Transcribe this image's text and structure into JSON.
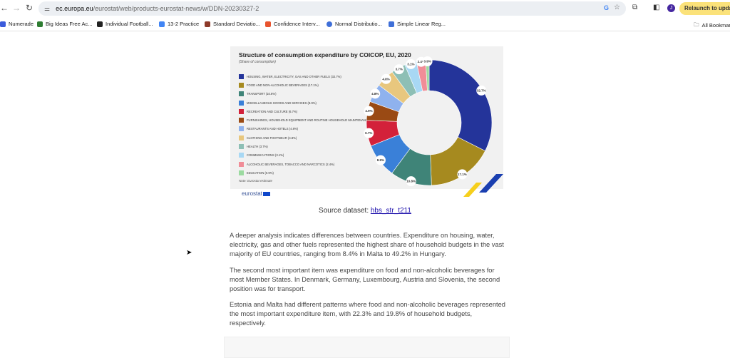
{
  "browser": {
    "url_host": "ec.europa.eu",
    "url_path": "/eurostat/web/products-eurostat-news/w/DDN-20230327-2",
    "relaunch_label": "Relaunch to update",
    "avatar_letter": "J"
  },
  "bookmarks": [
    {
      "label": "Numerade",
      "color": "#3b5bdb"
    },
    {
      "label": "Big Ideas Free Ac...",
      "color": "#2e7d32"
    },
    {
      "label": "Individual Football...",
      "color": "#222222"
    },
    {
      "label": "13-2 Practice",
      "color": "#4285f4"
    },
    {
      "label": "Standard Deviatio...",
      "color": "#8d3a2a"
    },
    {
      "label": "Confidence Interv...",
      "color": "#e8542f"
    },
    {
      "label": "Normal Distributio...",
      "color": "#3f6fd8"
    },
    {
      "label": "Simple Linear Reg...",
      "color": "#3f6fd8"
    }
  ],
  "all_bookmarks": "All Bookmarks",
  "chart_data": {
    "type": "pie",
    "title": "Structure of consumption expenditure by COICOP, EU, 2020",
    "subtitle": "(Share of consumption)",
    "note": "Note: Eurostat estimate",
    "logo": "eurostat",
    "categories": [
      "HOUSING, WATER, ELECTRICITY, GAS AND OTHER FUELS (32.7%)",
      "FOOD AND NON-ALCOHOLIC BEVERAGES (17.1%)",
      "TRANSPORT (10.8%)",
      "MISCELLANEOUS GOODS AND SERVICES (8.9%)",
      "RECREATION AND CULTURE (6.7%)",
      "FURNISHINGS, HOUSEHOLD EQUIPMENT AND ROUTINE HOUSEHOLD MAINTENANCE (4.9%)",
      "RESTAURANTS AND HOTELS (4.8%)",
      "CLOTHING AND FOOTWEAR (4.8%)",
      "HEALTH (3.7%)",
      "COMMUNICATIONS (3.1%)",
      "ALCOHOLIC BEVERAGES, TOBACCO AND NARCOTICS (2.4%)",
      "EDUCATION (0.9%)"
    ],
    "values": [
      32.7,
      17.1,
      10.8,
      8.9,
      6.7,
      4.9,
      4.8,
      4.8,
      3.7,
      3.1,
      2.4,
      0.9
    ],
    "labels": [
      "32.7%",
      "17.1%",
      "10.8%",
      "8.9%",
      "6.7%",
      "4.9%",
      "4.8%",
      "4.8%",
      "3.7%",
      "3.1%",
      "2.4%",
      "0.9%"
    ],
    "colors": [
      "#24349a",
      "#a68a1f",
      "#3f8478",
      "#3a80d8",
      "#d3213a",
      "#9a4a14",
      "#8fb2ee",
      "#e8c77e",
      "#8dbfb5",
      "#a8d8f4",
      "#f08d98",
      "#9bdaa0"
    ]
  },
  "source": {
    "prefix": "Source dataset: ",
    "link": "hbs_str_t211"
  },
  "paragraphs": [
    "A deeper analysis indicates differences between countries. Expenditure on housing, water, electricity, gas and other fuels represented the highest share of household budgets in the vast majority of EU countries, ranging from 8.4% in Malta to 49.2% in Hungary.",
    "The second most important item was expenditure on food and non-alcoholic beverages for most Member States. In Denmark, Germany, Luxembourg, Austria and Slovenia, the second position was for transport.",
    "Estonia and Malta had different patterns where food and non-alcoholic beverages represented the most important expenditure item, with 22.3% and 19.8% of household budgets, respectively."
  ]
}
